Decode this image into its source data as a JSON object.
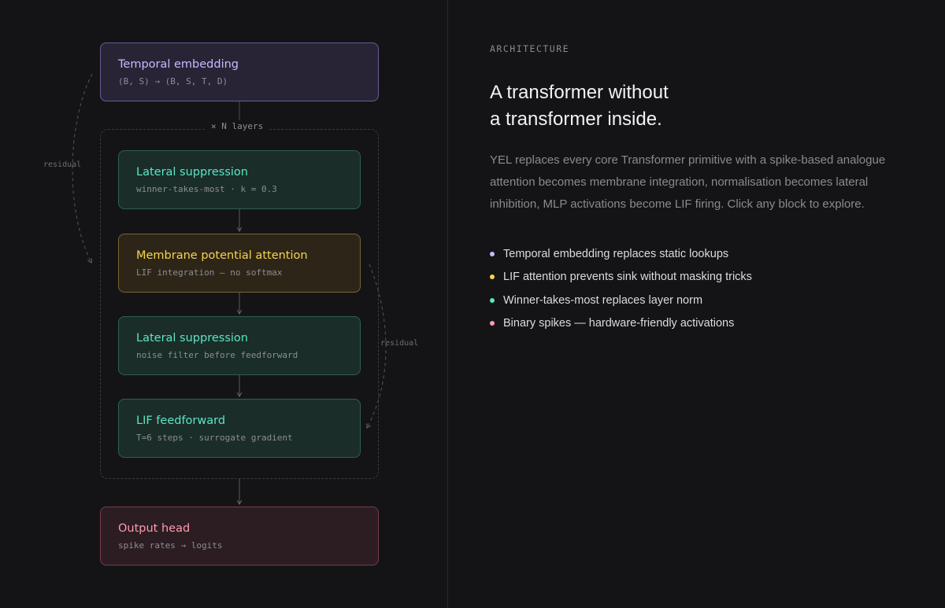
{
  "diagram": {
    "temporal": {
      "title": "Temporal embedding",
      "sub": "(B, S) → (B, S, T, D)"
    },
    "layers_label": "× N layers",
    "residual_left": "residual",
    "residual_right": "residual",
    "lateral1": {
      "title": "Lateral suppression",
      "sub": "winner-takes-most · k = 0.3"
    },
    "membrane": {
      "title": "Membrane potential attention",
      "sub": "LIF integration — no softmax"
    },
    "lateral2": {
      "title": "Lateral suppression",
      "sub": "noise filter before feedforward"
    },
    "lif": {
      "title": "LIF feedforward",
      "sub": "T=6 steps · surrogate gradient"
    },
    "output": {
      "title": "Output head",
      "sub": "spike rates → logits"
    }
  },
  "info": {
    "eyebrow": "ARCHITECTURE",
    "headline_line1": "A transformer without",
    "headline_line2": "a transformer inside.",
    "description": "YEL replaces every core Transformer primitive with a spike-based analogue attention becomes membrane integration, normalisation becomes lateral inhibition, MLP activations become LIF firing. Click any block to explore.",
    "features": [
      {
        "text": "Temporal embedding replaces static lookups",
        "color": "#cbb8ff"
      },
      {
        "text": "LIF attention prevents sink without masking tricks",
        "color": "#f5d44f"
      },
      {
        "text": "Winner-takes-most replaces layer norm",
        "color": "#5be6c2"
      },
      {
        "text": "Binary spikes — hardware-friendly activations",
        "color": "#ff9bb0"
      }
    ]
  },
  "colors": {
    "background": "#141416",
    "temporal": "#cbb8ff",
    "membrane": "#f5d44f",
    "lateral": "#5be6c2",
    "output": "#ff9bb0"
  }
}
